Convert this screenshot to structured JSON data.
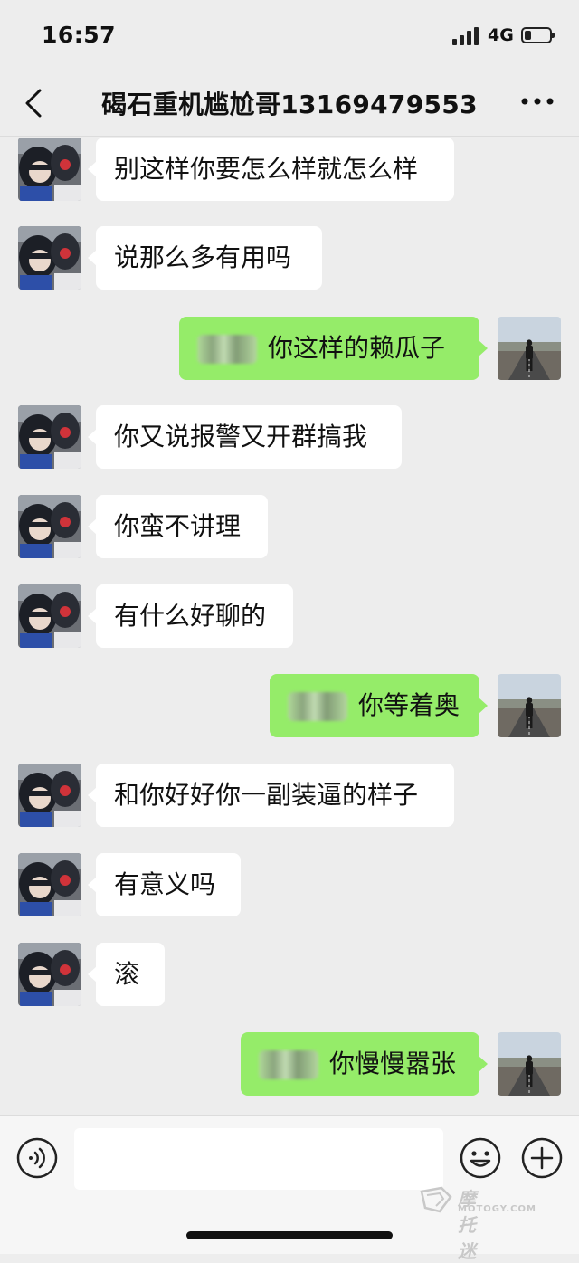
{
  "status_bar": {
    "time": "16:57",
    "network": "4G"
  },
  "header": {
    "title": "碣石重机尴尬哥13169479553"
  },
  "messages": [
    {
      "side": "left",
      "text": "别这样你要怎么样就怎么样"
    },
    {
      "side": "left",
      "text": "说那么多有用吗"
    },
    {
      "side": "right",
      "text": "你这样的赖瓜子"
    },
    {
      "side": "left",
      "text": "你又说报警又开群搞我"
    },
    {
      "side": "left",
      "text": "你蛮不讲理"
    },
    {
      "side": "left",
      "text": "有什么好聊的"
    },
    {
      "side": "right",
      "text": "你等着奥"
    },
    {
      "side": "left",
      "text": "和你好好你一副装逼的样子"
    },
    {
      "side": "left",
      "text": "有意义吗"
    },
    {
      "side": "left",
      "text": "滚"
    },
    {
      "side": "right",
      "text": "你慢慢嚣张"
    }
  ],
  "input": {
    "value": "",
    "placeholder": ""
  },
  "watermark": {
    "main": "摩托迷",
    "sub": "MOTOGY.COM"
  },
  "icons": {
    "back": "chevron-left-icon",
    "more": "more-dots-icon",
    "voice": "voice-icon",
    "emoji": "emoji-icon",
    "plus": "plus-icon"
  },
  "colors": {
    "background": "#ededed",
    "outgoing_bubble": "#95ec69",
    "incoming_bubble": "#ffffff"
  }
}
